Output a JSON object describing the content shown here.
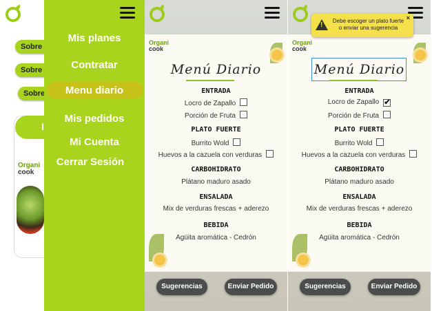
{
  "screen1": {
    "bg_buttons": [
      "Sobre l",
      "Sobre lo",
      "Sobre"
    ],
    "menu": [
      "Mis planes",
      "Contratar",
      "Menu diario",
      "Mis pedidos",
      "Mi Cuenta",
      "Cerrar Sesión"
    ],
    "active_item": "Menu diario",
    "card_brand": "Organi",
    "card_brand2": "cook",
    "card_letter": "I"
  },
  "menu": {
    "brand_top": "Organi",
    "brand_bottom": "cook",
    "title": "Menú Diario",
    "sections": {
      "entrada": "ENTRADA",
      "plato": "PLATO FUERTE",
      "carbo": "CARBOHIDRATO",
      "ensalada": "ENSALADA",
      "bebida": "BEBIDA"
    },
    "items": {
      "locro": "Locro de Zapallo",
      "fruta": "Porción de Fruta",
      "burrito": "Burrito Wold",
      "huevos": "Huevos a la cazuela con verduras",
      "platano": "Plátano maduro asado",
      "ensalada": "Mix de verduras frescas + aderezo",
      "bebida": "Agüita aromática - Cedrón"
    },
    "buttons": {
      "sugerencias": "Sugerencias",
      "enviar": "Enviar Pedido"
    }
  },
  "screen3": {
    "checked_item": "Locro de Zapallo",
    "check_mark": "✔",
    "tooltip": "Debe escoger un plato fuerte o enviar una sugerencia",
    "tooltip_close": "×"
  },
  "colors": {
    "accent": "#a9d41d",
    "active": "#c6c21a",
    "button": "#4b4d4c",
    "tooltip": "#f4e04a"
  },
  "icons": [
    "organicook-logo-icon",
    "hamburger-menu-icon",
    "warning-icon",
    "close-icon",
    "checkbox-icon"
  ]
}
